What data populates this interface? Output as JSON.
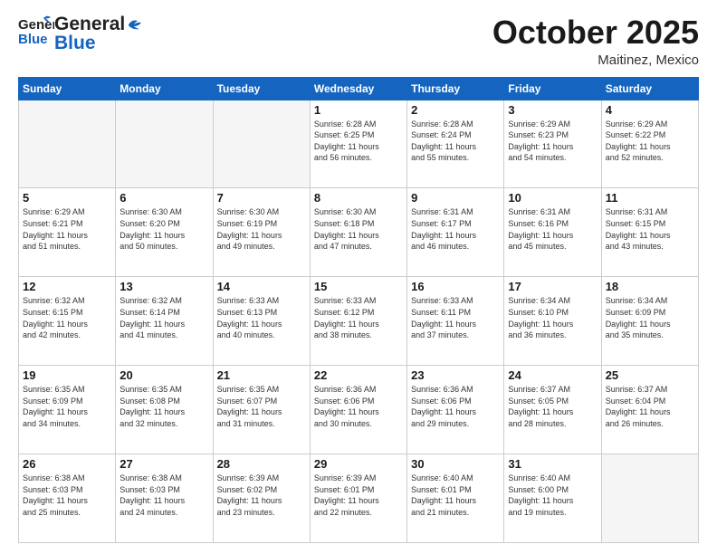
{
  "header": {
    "logo": {
      "general": "General",
      "blue": "Blue"
    },
    "title": "October 2025",
    "location": "Maitinez, Mexico"
  },
  "days_of_week": [
    "Sunday",
    "Monday",
    "Tuesday",
    "Wednesday",
    "Thursday",
    "Friday",
    "Saturday"
  ],
  "weeks": [
    [
      {
        "day": "",
        "info": ""
      },
      {
        "day": "",
        "info": ""
      },
      {
        "day": "",
        "info": ""
      },
      {
        "day": "1",
        "info": "Sunrise: 6:28 AM\nSunset: 6:25 PM\nDaylight: 11 hours\nand 56 minutes."
      },
      {
        "day": "2",
        "info": "Sunrise: 6:28 AM\nSunset: 6:24 PM\nDaylight: 11 hours\nand 55 minutes."
      },
      {
        "day": "3",
        "info": "Sunrise: 6:29 AM\nSunset: 6:23 PM\nDaylight: 11 hours\nand 54 minutes."
      },
      {
        "day": "4",
        "info": "Sunrise: 6:29 AM\nSunset: 6:22 PM\nDaylight: 11 hours\nand 52 minutes."
      }
    ],
    [
      {
        "day": "5",
        "info": "Sunrise: 6:29 AM\nSunset: 6:21 PM\nDaylight: 11 hours\nand 51 minutes."
      },
      {
        "day": "6",
        "info": "Sunrise: 6:30 AM\nSunset: 6:20 PM\nDaylight: 11 hours\nand 50 minutes."
      },
      {
        "day": "7",
        "info": "Sunrise: 6:30 AM\nSunset: 6:19 PM\nDaylight: 11 hours\nand 49 minutes."
      },
      {
        "day": "8",
        "info": "Sunrise: 6:30 AM\nSunset: 6:18 PM\nDaylight: 11 hours\nand 47 minutes."
      },
      {
        "day": "9",
        "info": "Sunrise: 6:31 AM\nSunset: 6:17 PM\nDaylight: 11 hours\nand 46 minutes."
      },
      {
        "day": "10",
        "info": "Sunrise: 6:31 AM\nSunset: 6:16 PM\nDaylight: 11 hours\nand 45 minutes."
      },
      {
        "day": "11",
        "info": "Sunrise: 6:31 AM\nSunset: 6:15 PM\nDaylight: 11 hours\nand 43 minutes."
      }
    ],
    [
      {
        "day": "12",
        "info": "Sunrise: 6:32 AM\nSunset: 6:15 PM\nDaylight: 11 hours\nand 42 minutes."
      },
      {
        "day": "13",
        "info": "Sunrise: 6:32 AM\nSunset: 6:14 PM\nDaylight: 11 hours\nand 41 minutes."
      },
      {
        "day": "14",
        "info": "Sunrise: 6:33 AM\nSunset: 6:13 PM\nDaylight: 11 hours\nand 40 minutes."
      },
      {
        "day": "15",
        "info": "Sunrise: 6:33 AM\nSunset: 6:12 PM\nDaylight: 11 hours\nand 38 minutes."
      },
      {
        "day": "16",
        "info": "Sunrise: 6:33 AM\nSunset: 6:11 PM\nDaylight: 11 hours\nand 37 minutes."
      },
      {
        "day": "17",
        "info": "Sunrise: 6:34 AM\nSunset: 6:10 PM\nDaylight: 11 hours\nand 36 minutes."
      },
      {
        "day": "18",
        "info": "Sunrise: 6:34 AM\nSunset: 6:09 PM\nDaylight: 11 hours\nand 35 minutes."
      }
    ],
    [
      {
        "day": "19",
        "info": "Sunrise: 6:35 AM\nSunset: 6:09 PM\nDaylight: 11 hours\nand 34 minutes."
      },
      {
        "day": "20",
        "info": "Sunrise: 6:35 AM\nSunset: 6:08 PM\nDaylight: 11 hours\nand 32 minutes."
      },
      {
        "day": "21",
        "info": "Sunrise: 6:35 AM\nSunset: 6:07 PM\nDaylight: 11 hours\nand 31 minutes."
      },
      {
        "day": "22",
        "info": "Sunrise: 6:36 AM\nSunset: 6:06 PM\nDaylight: 11 hours\nand 30 minutes."
      },
      {
        "day": "23",
        "info": "Sunrise: 6:36 AM\nSunset: 6:06 PM\nDaylight: 11 hours\nand 29 minutes."
      },
      {
        "day": "24",
        "info": "Sunrise: 6:37 AM\nSunset: 6:05 PM\nDaylight: 11 hours\nand 28 minutes."
      },
      {
        "day": "25",
        "info": "Sunrise: 6:37 AM\nSunset: 6:04 PM\nDaylight: 11 hours\nand 26 minutes."
      }
    ],
    [
      {
        "day": "26",
        "info": "Sunrise: 6:38 AM\nSunset: 6:03 PM\nDaylight: 11 hours\nand 25 minutes."
      },
      {
        "day": "27",
        "info": "Sunrise: 6:38 AM\nSunset: 6:03 PM\nDaylight: 11 hours\nand 24 minutes."
      },
      {
        "day": "28",
        "info": "Sunrise: 6:39 AM\nSunset: 6:02 PM\nDaylight: 11 hours\nand 23 minutes."
      },
      {
        "day": "29",
        "info": "Sunrise: 6:39 AM\nSunset: 6:01 PM\nDaylight: 11 hours\nand 22 minutes."
      },
      {
        "day": "30",
        "info": "Sunrise: 6:40 AM\nSunset: 6:01 PM\nDaylight: 11 hours\nand 21 minutes."
      },
      {
        "day": "31",
        "info": "Sunrise: 6:40 AM\nSunset: 6:00 PM\nDaylight: 11 hours\nand 19 minutes."
      },
      {
        "day": "",
        "info": ""
      }
    ]
  ]
}
